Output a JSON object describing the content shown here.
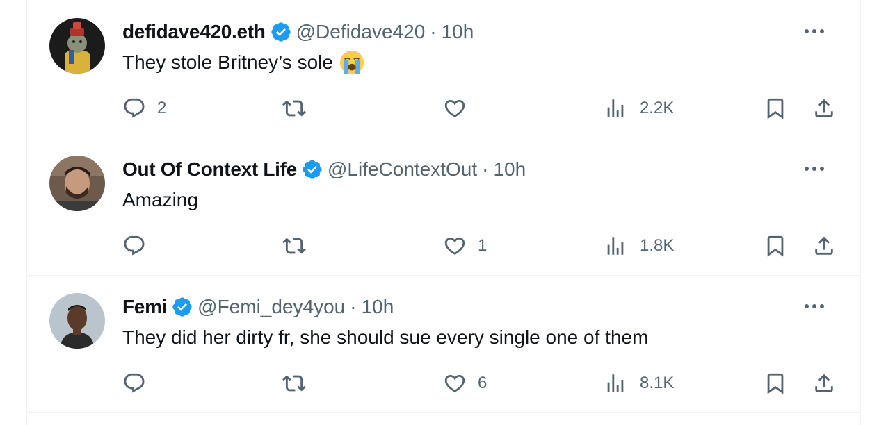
{
  "tweets": [
    {
      "name": "defidave420.eth",
      "handle": "@Defidave420",
      "separator": "·",
      "time": "10h",
      "text": "They stole Britney’s sole",
      "emoji": "loudly-crying-face",
      "replies": "2",
      "retweets": "",
      "likes": "",
      "views": "2.2K",
      "avatar": "cartoon-character-avatar"
    },
    {
      "name": "Out Of Context Life",
      "handle": "@LifeContextOut",
      "separator": "·",
      "time": "10h",
      "text": "Amazing",
      "replies": "",
      "retweets": "",
      "likes": "1",
      "views": "1.8K",
      "avatar": "bearded-man-photo-avatar"
    },
    {
      "name": "Femi",
      "handle": "@Femi_dey4you",
      "separator": "·",
      "time": "10h",
      "text": "They did her dirty fr, she should sue every single one of them",
      "replies": "",
      "retweets": "",
      "likes": "6",
      "views": "8.1K",
      "avatar": "man-photo-avatar"
    }
  ],
  "icons": {
    "verified": "verified-badge-icon",
    "more": "more-dots-icon",
    "reply": "reply-icon",
    "retweet": "retweet-icon",
    "like": "heart-icon",
    "views": "views-icon",
    "bookmark": "bookmark-icon",
    "share": "share-icon"
  },
  "colors": {
    "text": "#0f1419",
    "secondary": "#536471",
    "verified": "#1d9bf0",
    "divider": "#eff3f4"
  }
}
